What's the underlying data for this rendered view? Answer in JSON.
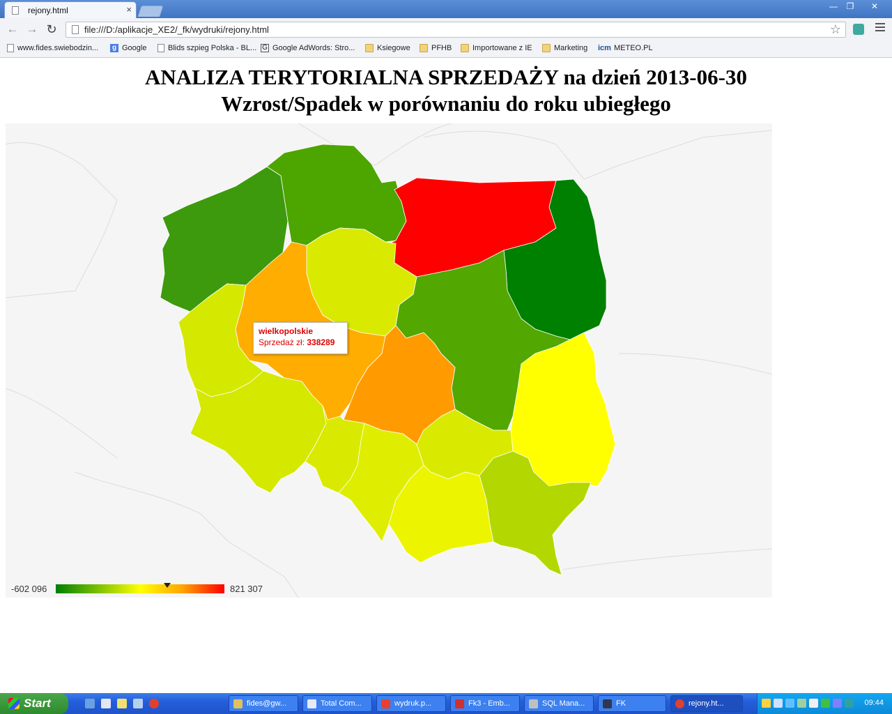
{
  "browser": {
    "tab_title": "rejony.html",
    "tab_close": "×",
    "url": "file:///D:/aplikacje_XE2/_fk/wydruki/rejony.html",
    "bookmarks": [
      {
        "label": "www.fides.swiebodzin...",
        "icon": "page-icon"
      },
      {
        "label": "Google",
        "icon": "google-icon"
      },
      {
        "label": "Blids szpieg Polska - BL...",
        "icon": "page-icon"
      },
      {
        "label": "Google AdWords: Stro...",
        "icon": "google-icon"
      },
      {
        "label": "Ksiegowe",
        "icon": "folder-icon"
      },
      {
        "label": "PFHB",
        "icon": "folder-icon"
      },
      {
        "label": "Importowane z IE",
        "icon": "folder-icon"
      },
      {
        "label": "Marketing",
        "icon": "folder-icon"
      },
      {
        "label": "METEO.PL",
        "icon": "icm-icon"
      }
    ]
  },
  "page": {
    "title_line1": "ANALIZA TERYTORIALNA SPRZEDAŻY na dzień 2013-06-30",
    "title_line2": "Wzrost/Spadek w porównaniu do roku ubiegłego"
  },
  "map": {
    "colors": {
      "zachodniopomorskie": "#3d9a0c",
      "pomorskie": "#4da500",
      "warminsko-mazurskie": "#ff0000",
      "podlaskie": "#008000",
      "kujawsko-pomorskie": "#d9ea00",
      "wielkopolskie": "#ffad00",
      "lubuskie": "#d5e800",
      "mazowieckie": "#52a700",
      "lodzkie": "#ff9b00",
      "lubelskie": "#ffff00",
      "dolnoslaskie": "#d4e800",
      "opolskie": "#d9ea00",
      "slaskie": "#dfee00",
      "swietokrzyskie": "#d9ea00",
      "malopolskie": "#ecf400",
      "podkarpackie": "#b3d700",
      "background": "#f5f5f5"
    },
    "tooltip": {
      "region": "wielkopolskie",
      "label": "Sprzedaż zł:",
      "value": "338289"
    },
    "legend": {
      "min": "-602 096",
      "max": "821 307",
      "marker_value": 338289
    }
  },
  "taskbar": {
    "start_label": "Start",
    "tasks": [
      {
        "label": "fides@gw...",
        "icon": "network-icon"
      },
      {
        "label": "Total Com...",
        "icon": "floppy-icon"
      },
      {
        "label": "wydruk.p...",
        "icon": "pdf-icon"
      },
      {
        "label": "Fk3 - Emb...",
        "icon": "app-icon"
      },
      {
        "label": "SQL Mana...",
        "icon": "sql-icon"
      },
      {
        "label": "FK",
        "icon": "app-icon"
      },
      {
        "label": "rejony.ht...",
        "icon": "chrome-icon"
      }
    ],
    "clock": "09:44"
  }
}
